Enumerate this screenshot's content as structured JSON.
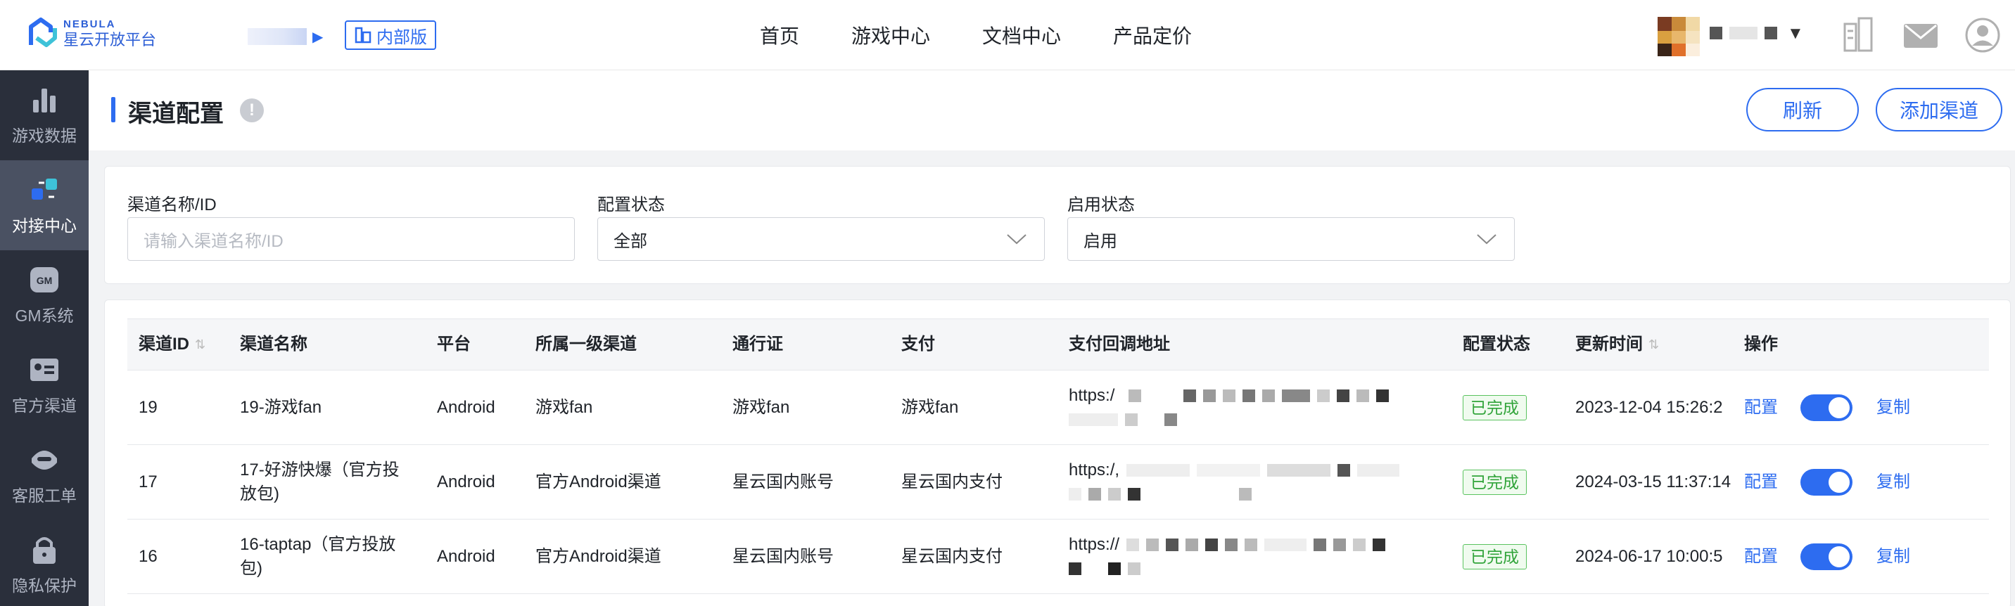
{
  "brand": {
    "name_en": "NEBULA",
    "name_cn": "星云开放平台"
  },
  "header": {
    "internal_tag": "内部版",
    "nav": [
      "首页",
      "游戏中心",
      "文档中心",
      "产品定价"
    ]
  },
  "sidebar": {
    "items": [
      {
        "label": "游戏数据",
        "icon": "bar-chart-icon",
        "active": false
      },
      {
        "label": "对接中心",
        "icon": "connect-icon",
        "active": true
      },
      {
        "label": "GM系统",
        "icon": "gm-icon",
        "active": false
      },
      {
        "label": "官方渠道",
        "icon": "id-card-icon",
        "active": false
      },
      {
        "label": "客服工单",
        "icon": "headset-icon",
        "active": false
      },
      {
        "label": "隐私保护",
        "icon": "lock-icon",
        "active": false
      }
    ]
  },
  "page": {
    "title": "渠道配置",
    "help": "!",
    "refresh_label": "刷新",
    "add_label": "添加渠道"
  },
  "filters": {
    "name_label": "渠道名称/ID",
    "name_placeholder": "请输入渠道名称/ID",
    "config_label": "配置状态",
    "config_value": "全部",
    "enable_label": "启用状态",
    "enable_value": "启用"
  },
  "table": {
    "columns": [
      "渠道ID",
      "渠道名称",
      "平台",
      "所属一级渠道",
      "通行证",
      "支付",
      "支付回调地址",
      "配置状态",
      "更新时间",
      "操作"
    ],
    "rows": [
      {
        "id": "19",
        "name": "19-游戏fan",
        "platform": "Android",
        "parent": "游戏fan",
        "passport": "游戏fan",
        "pay": "游戏fan",
        "callback": "https:/",
        "status": "已完成",
        "updated": "2023-12-04 15:26:2",
        "action_config": "配置",
        "action_copy": "复制",
        "enabled": true
      },
      {
        "id": "17",
        "name": "17-好游快爆（官方投放包)",
        "platform": "Android",
        "parent": "官方Android渠道",
        "passport": "星云国内账号",
        "pay": "星云国内支付",
        "callback": "https:/,",
        "status": "已完成",
        "updated": "2024-03-15 11:37:14",
        "action_config": "配置",
        "action_copy": "复制",
        "enabled": true
      },
      {
        "id": "16",
        "name": "16-taptap（官方投放包)",
        "platform": "Android",
        "parent": "官方Android渠道",
        "passport": "星云国内账号",
        "pay": "星云国内支付",
        "callback": "https://",
        "status": "已完成",
        "updated": "2024-06-17 10:00:5",
        "action_config": "配置",
        "action_copy": "复制",
        "enabled": true
      }
    ]
  },
  "colors": {
    "accent": "#2d6cf0",
    "sidebar_bg": "#2a2f3b",
    "success": "#31a43a"
  }
}
